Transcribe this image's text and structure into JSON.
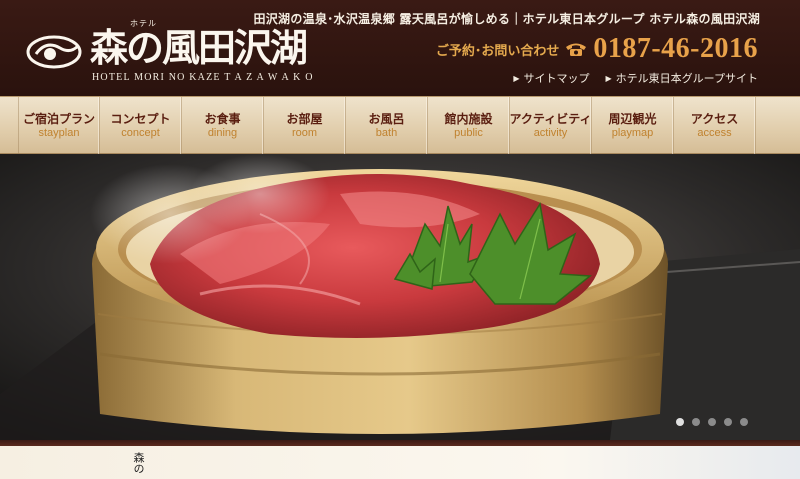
{
  "header": {
    "logo_kana": "ホテル",
    "logo_jp": "森の風田沢湖",
    "logo_en": "HOTEL MORI NO KAZE T A Z A W A K O",
    "tagline": "田沢湖の温泉･水沢温泉郷 露天風呂が愉しめる｜ホテル東日本グループ ホテル森の風田沢湖",
    "contact_label": "ご予約･お問い合わせ",
    "phone": "0187-46-2016",
    "links": [
      {
        "label": "サイトマップ"
      },
      {
        "label": "ホテル東日本グループサイト"
      }
    ]
  },
  "nav": {
    "items": [
      {
        "jp": "ご宿泊プラン",
        "en": "stayplan"
      },
      {
        "jp": "コンセプト",
        "en": "concept"
      },
      {
        "jp": "お食事",
        "en": "dining"
      },
      {
        "jp": "お部屋",
        "en": "room"
      },
      {
        "jp": "お風呂",
        "en": "bath"
      },
      {
        "jp": "館内施設",
        "en": "public"
      },
      {
        "jp": "アクティビティ",
        "en": "activity"
      },
      {
        "jp": "周辺観光",
        "en": "playmap"
      },
      {
        "jp": "アクセス",
        "en": "access"
      }
    ]
  },
  "hero": {
    "slide_count": 5,
    "active_slide": 1
  },
  "bottom": {
    "vertical_text": "森の"
  },
  "colors": {
    "header_bg": "#2a120d",
    "accent_orange": "#e8a24a",
    "nav_text": "#5a1e10",
    "nav_sub": "#c0822f"
  }
}
